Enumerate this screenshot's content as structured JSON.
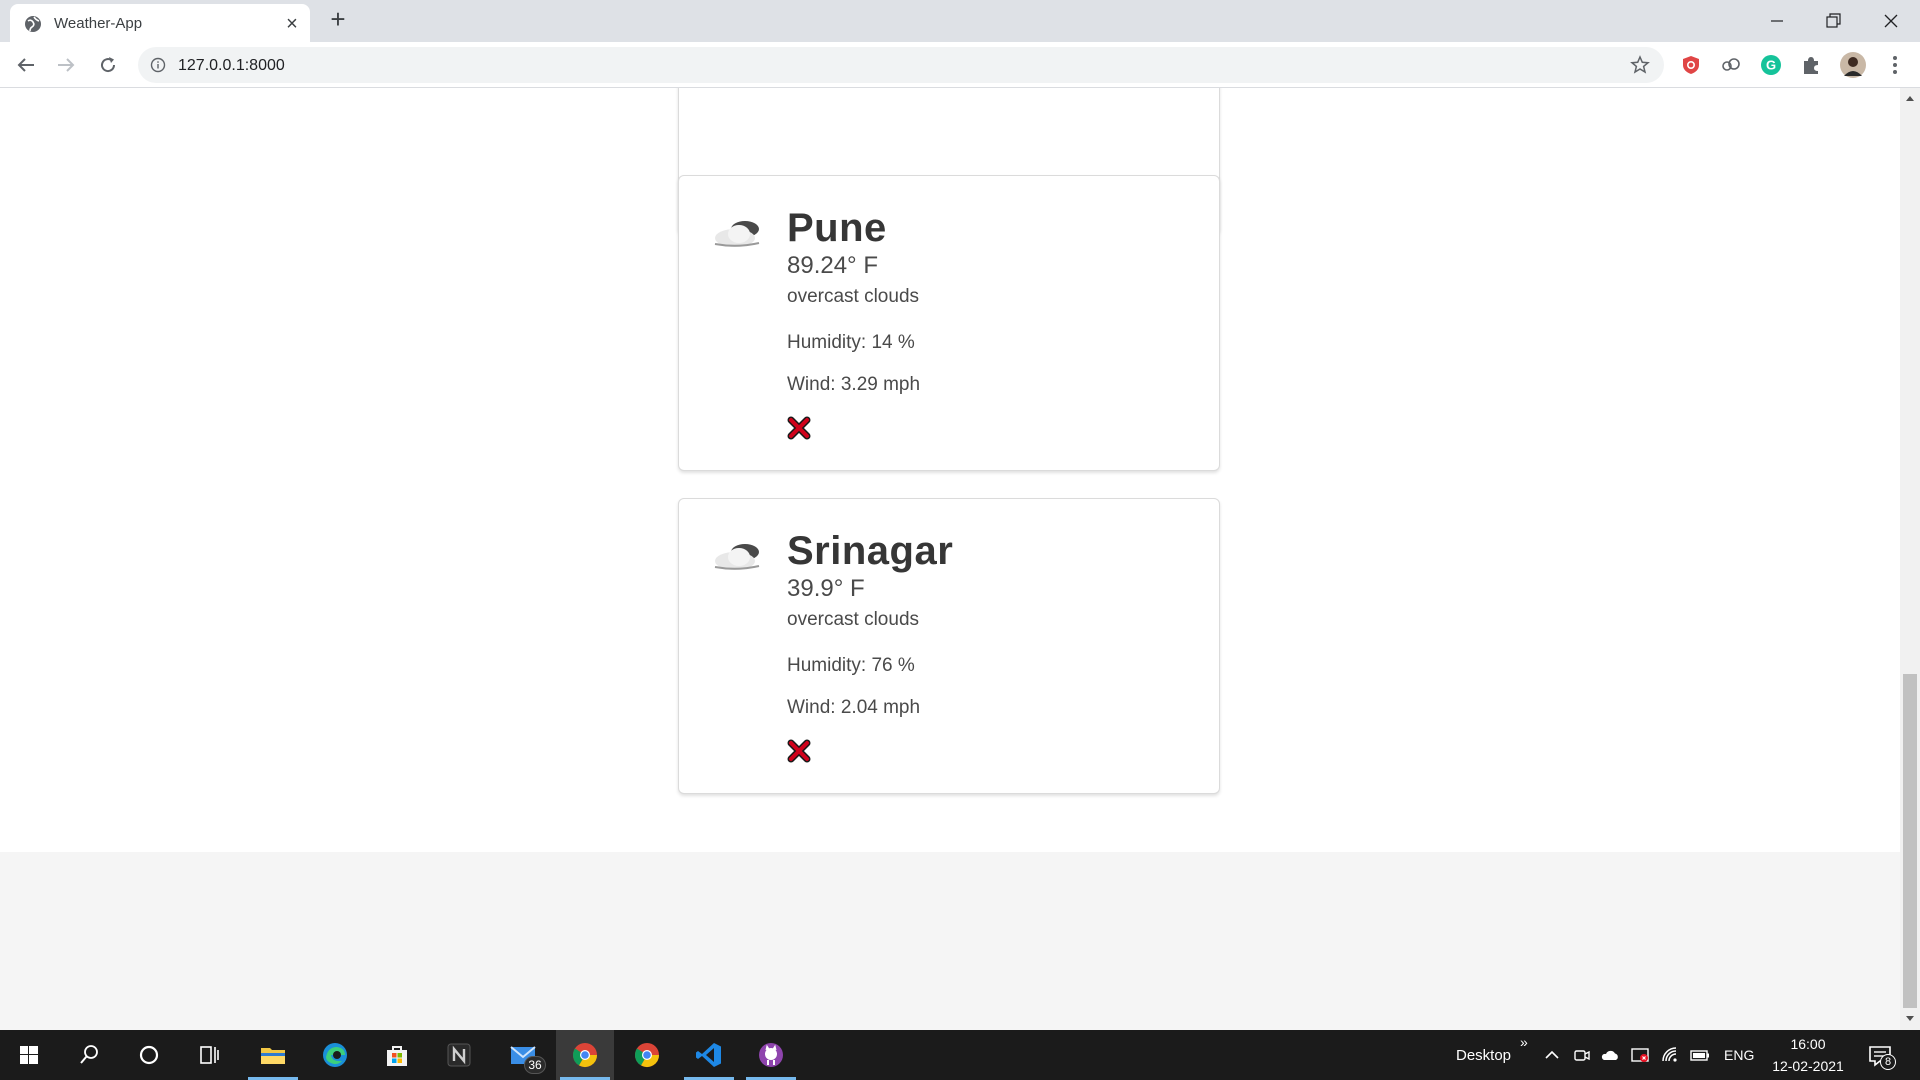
{
  "browser": {
    "tab_title": "Weather-App",
    "url": "127.0.0.1:8000"
  },
  "colors": {
    "delete_red": "#d0021b",
    "page_footer": "#f5f5f5",
    "taskbar": "#1b1b1b"
  },
  "cards": [
    {
      "city": "Pune",
      "temperature": "89.24° F",
      "description": "overcast clouds",
      "humidity": "Humidity: 14 %",
      "wind": "Wind: 3.29 mph",
      "icon": "overcast-clouds-icon"
    },
    {
      "city": "Srinagar",
      "temperature": "39.9° F",
      "description": "overcast clouds",
      "humidity": "Humidity: 76 %",
      "wind": "Wind: 2.04 mph",
      "icon": "overcast-clouds-icon"
    }
  ],
  "taskbar": {
    "mail_badge": "36",
    "desktop_label": "Desktop",
    "chevrons": "»",
    "language": "ENG",
    "time": "16:00",
    "date": "12-02-2021",
    "notification_count": "8"
  }
}
